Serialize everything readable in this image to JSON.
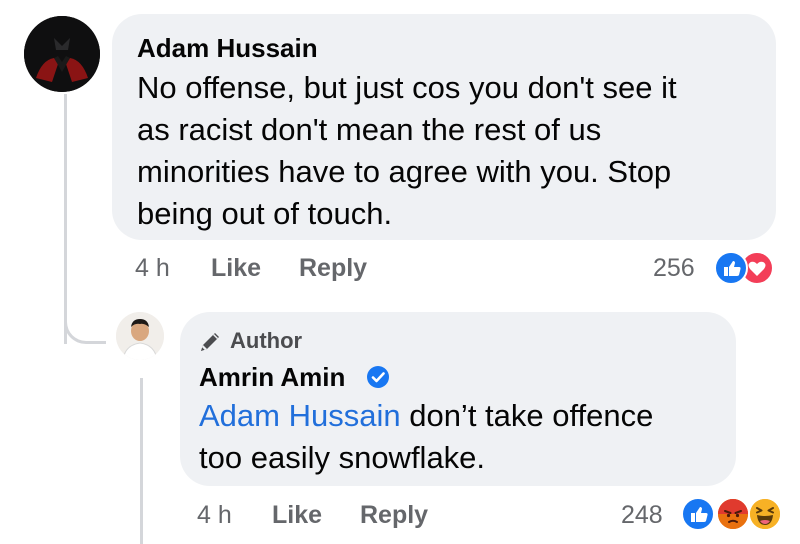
{
  "comment": {
    "author": "Adam Hussain",
    "text_lines": [
      "No offense, but just cos you don't see it",
      "as racist don't mean the rest of us",
      "minorities have to agree with you. Stop",
      "being out of touch."
    ],
    "time": "4 h",
    "like_label": "Like",
    "reply_label": "Reply",
    "reaction_count": "256",
    "reactions": [
      "like-icon",
      "love-icon"
    ]
  },
  "reply": {
    "badge_label": "Author",
    "badge_icon": "pencil-icon",
    "author": "Amrin Amin",
    "verified_icon": "verified-badge-icon",
    "mention": "Adam Hussain",
    "text_line1_rest": " don’t take offence",
    "text_line2": "too easily snowflake.",
    "time": "4 h",
    "like_label": "Like",
    "reply_label": "Reply",
    "reaction_count": "248",
    "reactions": [
      "like-icon",
      "angry-icon",
      "haha-icon"
    ]
  },
  "colors": {
    "bubble": "#eff1f4",
    "text": "#050505",
    "meta": "#65676b",
    "mention": "#216fdb",
    "like_blue": "#1877f2",
    "love_red": "#f33e58",
    "angry_orange": "#e9710f",
    "haha_yellow": "#f7b125"
  }
}
